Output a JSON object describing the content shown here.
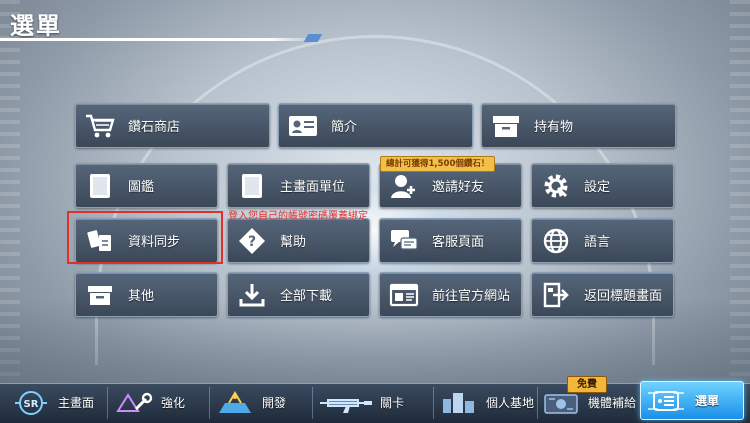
{
  "header": {
    "title": "選單"
  },
  "menu": {
    "rows": [
      [
        {
          "label": "鑽石商店",
          "icon": "shopping-cart-icon"
        },
        {
          "label": "簡介",
          "icon": "profile-card-icon"
        },
        {
          "label": "持有物",
          "icon": "inventory-box-icon"
        }
      ],
      [
        {
          "label": "圖鑑",
          "icon": "book-icon"
        },
        {
          "label": "主畫面單位",
          "icon": "unit-card-icon"
        },
        {
          "label": "邀請好友",
          "icon": "add-friend-icon"
        },
        {
          "label": "設定",
          "icon": "gear-icon"
        }
      ],
      [
        {
          "label": "資料同步",
          "icon": "data-sync-icon"
        },
        {
          "label": "幫助",
          "icon": "help-icon"
        },
        {
          "label": "客服頁面",
          "icon": "chat-bubbles-icon"
        },
        {
          "label": "語言",
          "icon": "globe-icon"
        }
      ],
      [
        {
          "label": "其他",
          "icon": "box-icon"
        },
        {
          "label": "全部下載",
          "icon": "download-icon"
        },
        {
          "label": "前往官方網站",
          "icon": "website-icon"
        },
        {
          "label": "返回標題畫面",
          "icon": "return-title-icon"
        }
      ]
    ],
    "invite_badge": "總計可獲得1,500個鑽石！",
    "sync_annotation": "登入您自己的帳號密碼覆蓋綁定"
  },
  "bottom_nav": {
    "items": [
      {
        "label": "主畫面",
        "icon": "home-emblem-icon"
      },
      {
        "label": "強化",
        "icon": "wrench-icon"
      },
      {
        "label": "開發",
        "icon": "develop-icon"
      },
      {
        "label": "關卡",
        "icon": "rifle-icon"
      },
      {
        "label": "個人基地",
        "icon": "base-icon"
      },
      {
        "label": "機體補給",
        "icon": "supply-icon"
      },
      {
        "label": "選單",
        "icon": "menu-icon"
      }
    ],
    "free_tag": "免費",
    "active": "選單"
  },
  "colors": {
    "button_bg": "#4a596c",
    "annotation": "#e0302a",
    "active_nav": "#1a8fe8",
    "badge": "#f2c04a"
  }
}
